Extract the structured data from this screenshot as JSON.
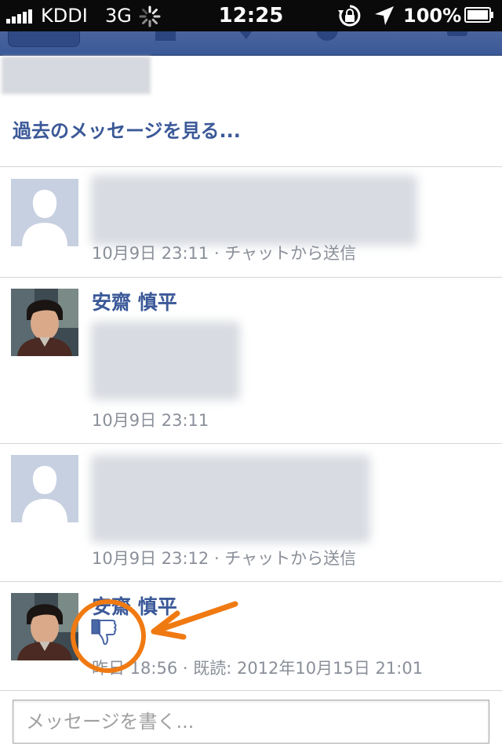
{
  "status_bar": {
    "carrier": "KDDI",
    "network": "3G",
    "time": "12:25",
    "battery_percent": "100%"
  },
  "thread": {
    "older_messages_label": "過去のメッセージを見る..."
  },
  "messages": [
    {
      "sender": "",
      "meta": "10月9日 23:11 · チャットから送信"
    },
    {
      "sender": "安齋 慎平",
      "meta": "10月9日 23:11"
    },
    {
      "sender": "",
      "meta": "10月9日 23:12 · チャットから送信"
    },
    {
      "sender": "安齋 慎平",
      "meta": "昨日 18:56 · 既読: 2012年10月15日 21:01"
    }
  ],
  "compose": {
    "placeholder": "メッセージを書く..."
  },
  "colors": {
    "brand": "#3b5998",
    "annotation": "#f07a12"
  },
  "icons": [
    "signal-icon",
    "loading-spinner-icon",
    "rotation-lock-icon",
    "location-arrow-icon",
    "battery-icon",
    "default-avatar-icon",
    "thumbs-down-icon"
  ]
}
